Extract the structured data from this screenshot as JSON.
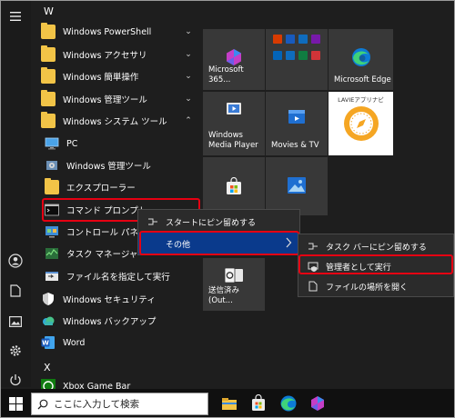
{
  "app_list": {
    "letter_w": "W",
    "letter_x": "X",
    "items": [
      {
        "label": "Windows PowerShell"
      },
      {
        "label": "Windows アクセサリ"
      },
      {
        "label": "Windows 簡単操作"
      },
      {
        "label": "Windows 管理ツール"
      },
      {
        "label": "Windows システム ツール"
      },
      {
        "label": "PC"
      },
      {
        "label": "Windows 管理ツール"
      },
      {
        "label": "エクスプローラー"
      },
      {
        "label": "コマンド プロンプト"
      },
      {
        "label": "コントロール パネル"
      },
      {
        "label": "タスク マネージャー"
      },
      {
        "label": "ファイル名を指定して実行"
      },
      {
        "label": "Windows セキュリティ"
      },
      {
        "label": "Windows バックアップ"
      },
      {
        "label": "Word"
      },
      {
        "label": "Xbox Game Bar"
      }
    ],
    "chevron_down": "⌄",
    "chevron_up": "⌃"
  },
  "tiles": [
    {
      "label": "Microsoft 365..."
    },
    {
      "label": ""
    },
    {
      "label": "Microsoft Edge"
    },
    {
      "label": "Windows\nMedia Player"
    },
    {
      "label": "Movies & TV"
    },
    {
      "label": "LAVIEアプリナビ"
    },
    {
      "label": "送信済み (Out..."
    }
  ],
  "context_menu": {
    "pin_start": "スタートにピン留めする",
    "more": "その他"
  },
  "submenu": {
    "pin_taskbar": "タスク バーにピン留めする",
    "run_admin": "管理者として実行",
    "open_location": "ファイルの場所を開く"
  },
  "taskbar": {
    "search_placeholder": "ここに入力して検索"
  },
  "colors": {
    "highlight_red": "#e60012",
    "menu_selected": "#0a3a8c",
    "background": "#1e1e1e"
  }
}
